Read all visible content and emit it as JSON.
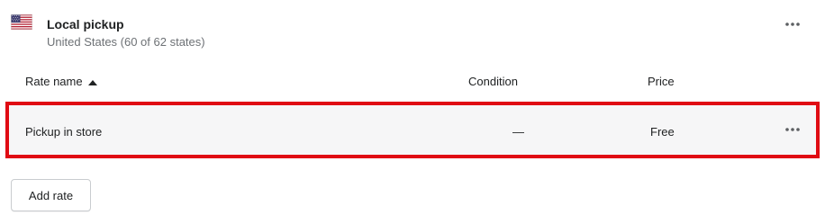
{
  "zone": {
    "flag_icon": "us-flag-icon",
    "title": "Local pickup",
    "subtitle": "United States (60 of 62 states)",
    "more_icon": "horizontal-dots-icon"
  },
  "table": {
    "columns": [
      {
        "label": "Rate name",
        "sort": "ascending",
        "sort_icon": "caret-up-icon"
      },
      {
        "label": "Condition"
      },
      {
        "label": "Price"
      }
    ],
    "rows": [
      {
        "name": "Pickup in store",
        "condition": "—",
        "price": "Free",
        "highlighted": true,
        "more_icon": "horizontal-dots-icon"
      }
    ]
  },
  "actions": {
    "add_rate_label": "Add rate"
  },
  "colors": {
    "highlight_border": "#e00b13",
    "row_background": "#f6f6f7",
    "text": "#202223",
    "subdued_text": "#6d7175"
  }
}
